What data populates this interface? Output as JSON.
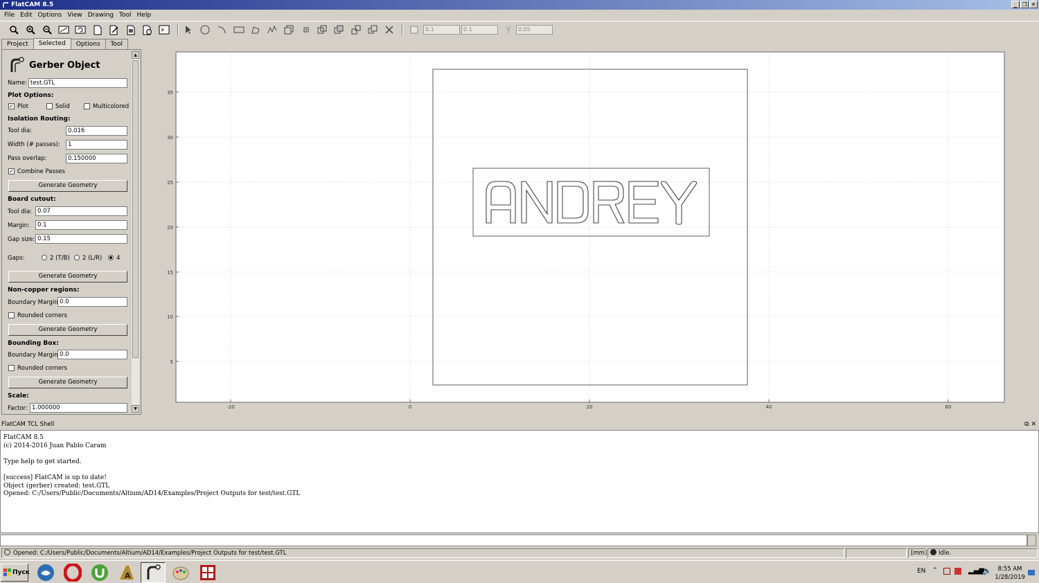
{
  "window": {
    "title": "FlatCAM 8.5"
  },
  "menu": [
    "File",
    "Edit",
    "Options",
    "View",
    "Drawing",
    "Tool",
    "Help"
  ],
  "toolbar": {
    "icons": [
      "zoom-fit-icon",
      "zoom-in-icon",
      "zoom-out-icon",
      "clear-plot-icon",
      "replot-icon",
      "new-geometry-icon",
      "edit-geometry-icon",
      "update-geometry-icon",
      "delete-icon",
      "shell-icon"
    ],
    "draw_icons": [
      "select-icon",
      "circle-icon",
      "arc-icon",
      "rectangle-icon",
      "polygon-icon",
      "path-icon",
      "move-icon",
      "copy-icon",
      "union-icon",
      "intersection-icon",
      "subtract-icon",
      "cut-icon",
      "close-icon"
    ],
    "grid_x": "0.1",
    "grid_y": "0.1",
    "snap_max": "0.05"
  },
  "tabs": [
    "Project",
    "Selected",
    "Options",
    "Tool"
  ],
  "panel": {
    "title": "Gerber Object",
    "name_label": "Name:",
    "name_value": "test.GTL",
    "plot_options_heading": "Plot Options:",
    "plot_label": "Plot",
    "solid_label": "Solid",
    "multicolored_label": "Multicolored",
    "isolation_heading": "Isolation Routing:",
    "iso_tool_dia_label": "Tool dia:",
    "iso_tool_dia_value": "0.016",
    "iso_width_label": "Width (# passes):",
    "iso_width_value": "1",
    "iso_overlap_label": "Pass overlap:",
    "iso_overlap_value": "0.150000",
    "combine_label": "Combine Passes",
    "generate_geometry": "Generate Geometry",
    "cutout_heading": "Board cutout:",
    "cut_tool_dia_label": "Tool dia:",
    "cut_tool_dia_value": "0.07",
    "cut_margin_label": "Margin:",
    "cut_margin_value": "0.1",
    "cut_gap_label": "Gap size:",
    "cut_gap_value": "0.15",
    "gaps_label": "Gaps:",
    "gaps_options": [
      "2 (T/B)",
      "2 (L/R)",
      "4"
    ],
    "noncopper_heading": "Non-copper regions:",
    "nc_margin_label": "Boundary Margin:",
    "nc_margin_value": "0.0",
    "nc_rounded_label": "Rounded corners",
    "bbox_heading": "Bounding Box:",
    "bb_margin_label": "Boundary Margin:",
    "bb_margin_value": "0.0",
    "bb_rounded_label": "Rounded corners",
    "scale_heading": "Scale:",
    "factor_label": "Factor:",
    "factor_value": "1.000000"
  },
  "plot": {
    "x_ticks": [
      "-20",
      "0",
      "20",
      "40",
      "60"
    ],
    "y_ticks": [
      "35",
      "30",
      "25",
      "20",
      "15",
      "10",
      "5"
    ],
    "text": "ANDREY"
  },
  "shell": {
    "title": "FlatCAM TCL Shell",
    "lines": [
      "FlatCAM 8.5",
      "(c) 2014-2016 Juan Pablo Caram",
      "",
      "Type help to get started.",
      "",
      "[success] FlatCAM is up to date!",
      "Object (gerber) created: test.GTL",
      "Opened: C:/Users/Public/Documents/Altium/AD14/Examples/Project Outputs for test/test.GTL"
    ]
  },
  "status": {
    "message": "Opened: C:/Users/Public/Documents/Altium/AD14/Examples/Project Outputs for test/test.GTL",
    "units": "[mm]",
    "state": "Idle."
  },
  "taskbar": {
    "start": "Пуск",
    "lang": "EN",
    "time": "8:55 AM",
    "date": "1/28/2019"
  }
}
